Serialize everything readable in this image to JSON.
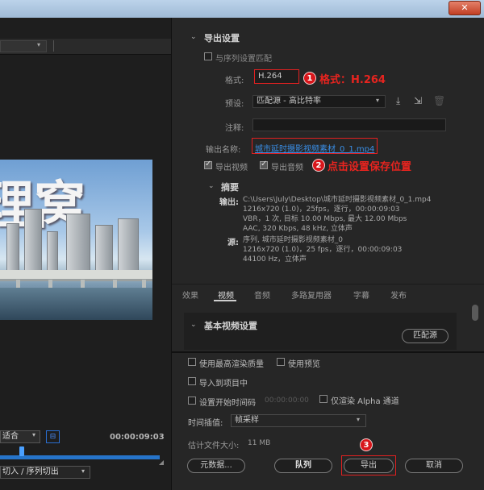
{
  "window": {
    "close_glyph": "✕"
  },
  "left": {
    "preview_chars": "理窝",
    "zoom_value": "适合",
    "timecode": "00:00:09:03",
    "source_range": "切入 / 序列切出"
  },
  "export_settings": {
    "section_title": "导出设置",
    "match_sequence_label": "与序列设置匹配",
    "format_label": "格式:",
    "format_value": "H.264",
    "preset_label": "预设:",
    "preset_value": "匹配源 - 高比特率",
    "comment_label": "注释:",
    "comment_value": "",
    "output_name_label": "输出名称:",
    "output_name_value": "城市延时摄影视频素材_0_1.mp4",
    "export_video_label": "导出视频",
    "export_audio_label": "导出音频"
  },
  "annotations": {
    "a1_num": "1",
    "a1_text": "格式：H.264",
    "a2_num": "2",
    "a2_text": "点击设置保存位置",
    "a3_num": "3"
  },
  "summary": {
    "title": "摘要",
    "output_label": "输出:",
    "output_lines": [
      "C:\\Users\\July\\Desktop\\城市延时摄影视频素材_0_1.mp4",
      "1216x720 (1.0)，25fps，逐行，00:00:09:03",
      "VBR，1 次, 目标 10.00 Mbps, 最大 12.00 Mbps",
      "AAC, 320 Kbps, 48 kHz, 立体声"
    ],
    "source_label": "源:",
    "source_lines": [
      "序列, 城市延时摄影视频素材_0",
      "1216x720 (1.0)，25 fps，逐行，00:00:09:03",
      "44100 Hz，立体声"
    ]
  },
  "tabs": [
    "效果",
    "视频",
    "音频",
    "多路复用器",
    "字幕",
    "发布"
  ],
  "video_panel": {
    "section_title": "基本视频设置",
    "match_source_button": "匹配源"
  },
  "bottom": {
    "max_render_quality": "使用最高渲染质量",
    "use_previews": "使用预览",
    "import_into_project": "导入到项目中",
    "set_start_timecode": "设置开始时间码",
    "start_timecode_value": "00:00:00:00",
    "render_alpha_only": "仅渲染 Alpha 通道",
    "time_interpolation_label": "时间插值:",
    "time_interpolation_value": "帧采样",
    "file_size_label": "估计文件大小:",
    "file_size_value": "11 MB",
    "metadata_button": "元数据...",
    "queue_button": "队列",
    "export_button": "导出",
    "cancel_button": "取消"
  }
}
